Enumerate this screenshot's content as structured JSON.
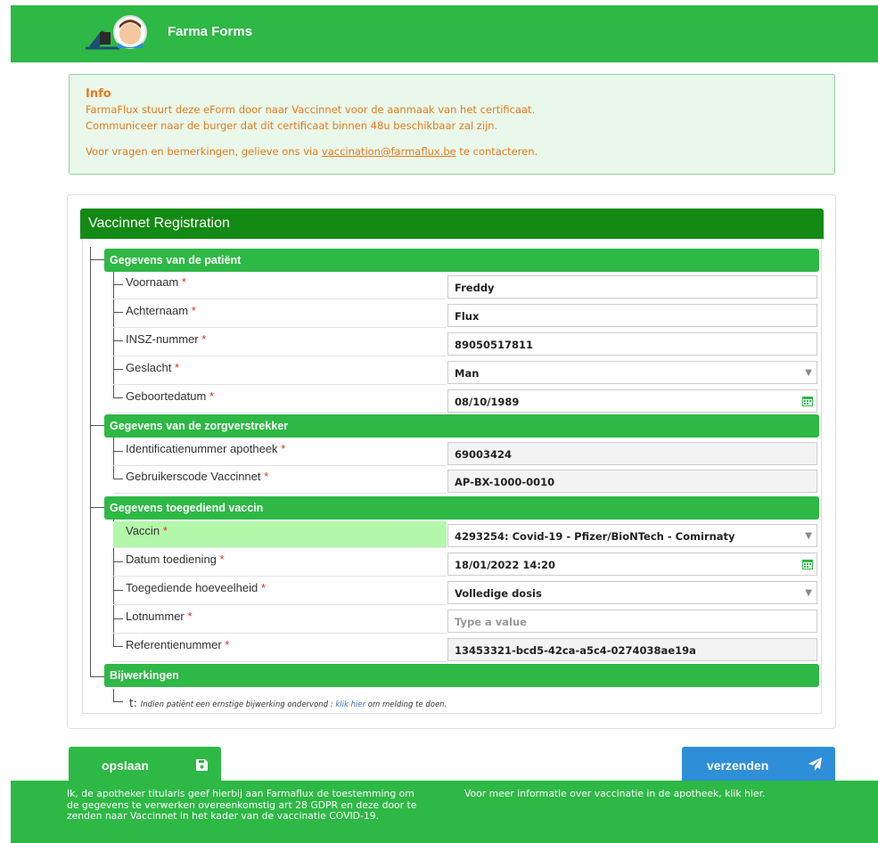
{
  "header": {
    "brand": "Farma Forms",
    "logo_icon": "pharmacist-logo-icon"
  },
  "info": {
    "title": "Info",
    "line1": "FarmaFlux stuurt deze eForm door naar Vaccinnet voor de aanmaak van het certificaat.",
    "line2": "Communiceer naar de burger dat dit certificaat binnen 48u beschikbaar zal zijn.",
    "contact_prefix": "Voor vragen en bemerkingen, gelieve ons via ",
    "contact_email": "vaccination@farmaflux.be",
    "contact_suffix": " te contacteren."
  },
  "form": {
    "title": "Vaccinnet Registration",
    "required_marker": "*",
    "sections": {
      "patient": "Gegevens van de patiënt",
      "provider": "Gegevens van de zorgverstrekker",
      "vaccine": "Gegevens toegediend vaccin",
      "side_effects": "Bijwerkingen"
    },
    "fields": {
      "voornaam": {
        "label": "Voornaam",
        "value": "Freddy"
      },
      "achternaam": {
        "label": "Achternaam",
        "value": "Flux"
      },
      "insz": {
        "label": "INSZ-nummer",
        "value": "89050517811"
      },
      "geslacht": {
        "label": "Geslacht",
        "value": "Man"
      },
      "geboortedatum": {
        "label": "Geboortedatum",
        "value": "08/10/1989"
      },
      "apotheek_id": {
        "label": "Identificatienummer apotheek",
        "value": "69003424"
      },
      "gebruikerscode": {
        "label": "Gebruikerscode Vaccinnet",
        "value": "AP-BX-1000-0010"
      },
      "vaccin": {
        "label": "Vaccin",
        "value": "4293254: Covid-19 - Pfizer/BioNTech - Comirnaty"
      },
      "datum_toediening": {
        "label": "Datum toediening",
        "value": "18/01/2022 14:20"
      },
      "hoeveelheid": {
        "label": "Toegediende hoeveelheid",
        "value": "Volledige dosis"
      },
      "lotnummer": {
        "label": "Lotnummer",
        "placeholder": "Type a value"
      },
      "referentienummer": {
        "label": "Referentienummer",
        "value": "13453321-bcd5-42ca-a5c4-0274038ae19a"
      }
    },
    "side_effects_note": {
      "prefix": "t:",
      "text_before": "Indien patiënt een ernstige bijwerking ondervond : ",
      "link": "klik hier",
      "text_after": " om melding te doen."
    }
  },
  "actions": {
    "save": "opslaan",
    "send": "verzenden"
  },
  "footer": {
    "consent": "Ik, de apotheker titularis geef hierbij aan Farmaflux de toestemming om de gegevens te verwerken overeenkomstig art 28 GDPR en deze door te zenden naar Vaccinnet in het kader van de vaccinatie COVID-19.",
    "more_info": "Voor meer informatie over vaccinatie in de apotheek, klik hier."
  },
  "colors": {
    "primary_green": "#2eb845",
    "dark_green": "#138a13",
    "accent_orange": "#e8791d",
    "send_blue": "#2f8ed8",
    "highlight_row": "#b3f7ab"
  }
}
